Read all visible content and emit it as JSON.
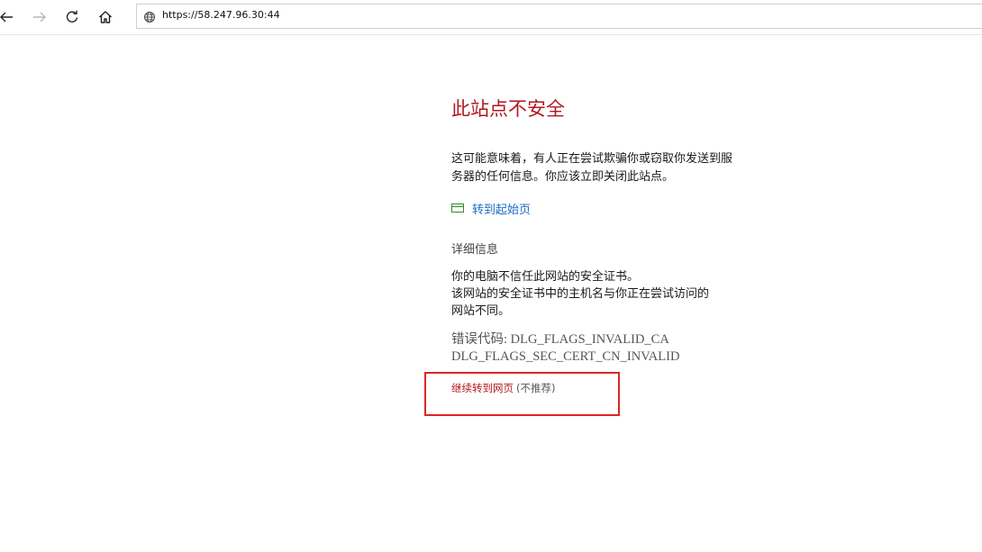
{
  "browser": {
    "url": "https://58.247.96.30:44",
    "icons": {
      "back": "back-arrow-icon",
      "forward": "forward-arrow-icon",
      "refresh": "refresh-icon",
      "home": "home-icon",
      "site_info": "globe-icon"
    }
  },
  "warning": {
    "title": "此站点不安全",
    "description": "这可能意味着，有人正在尝试欺骗你或窃取你发送到服务器的任何信息。你应该立即关闭此站点。",
    "start_page_link": "转到起始页",
    "details_heading": "详细信息",
    "details_line1": "你的电脑不信任此网站的安全证书。",
    "details_line2": "该网站的安全证书中的主机名与你正在尝试访问的",
    "details_line3": "网站不同。",
    "error_code_line1": "错误代码: DLG_FLAGS_INVALID_CA",
    "error_code_line2": "DLG_FLAGS_SEC_CERT_CN_INVALID",
    "continue_link": "继续转到网页",
    "continue_note": "(不推荐)"
  },
  "colors": {
    "title_red": "#b1181e",
    "link_blue": "#1c6bc4",
    "icon_green": "#2f8a2f",
    "annotation_red": "#e02424"
  }
}
